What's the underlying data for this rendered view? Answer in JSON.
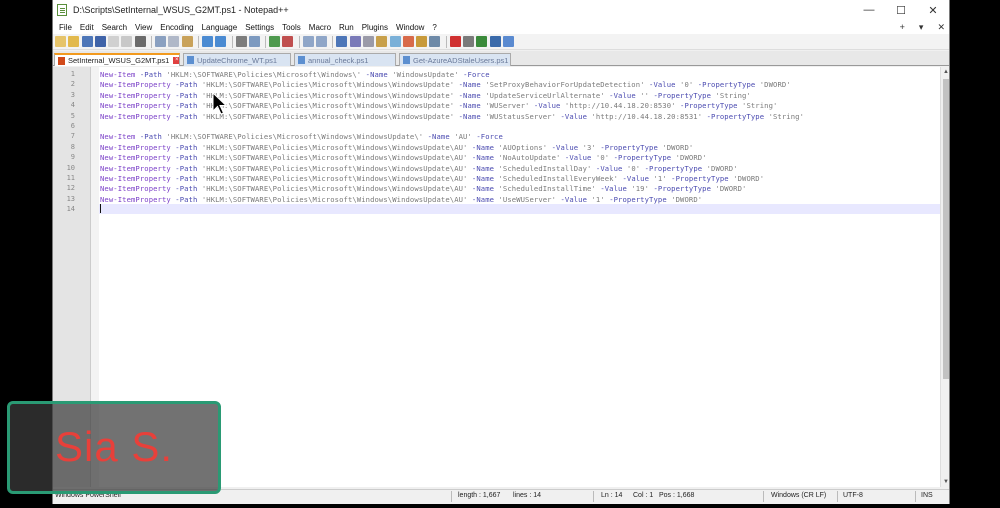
{
  "window": {
    "title": "D:\\Scripts\\SetInternal_WSUS_G2MT.ps1 - Notepad++",
    "controls": {
      "minimize": "—",
      "maximize": "☐",
      "close": "✕"
    }
  },
  "menu": {
    "items": [
      "File",
      "Edit",
      "Search",
      "View",
      "Encoding",
      "Language",
      "Settings",
      "Tools",
      "Macro",
      "Run",
      "Plugins",
      "Window",
      "?"
    ],
    "right": {
      "plus": "+",
      "down": "▾",
      "close": "✕"
    }
  },
  "tabs": [
    {
      "label": "SetInternal_WSUS_G2MT.ps1",
      "active": true
    },
    {
      "label": "UpdateChrome_WT.ps1",
      "active": false
    },
    {
      "label": "annual_check.ps1",
      "active": false
    },
    {
      "label": "Get-AzureADStaleUsers.ps1",
      "active": false
    }
  ],
  "editor": {
    "lines": [
      {
        "n": "1",
        "parts": [
          [
            "cmd",
            "New-Item"
          ],
          [
            "prm",
            " -Path "
          ],
          [
            "str",
            "'HKLM:\\SOFTWARE\\Policies\\Microsoft\\Windows\\'"
          ],
          [
            "prm",
            " -Name "
          ],
          [
            "str",
            "'WindowsUpdate'"
          ],
          [
            "prm",
            " -Force"
          ]
        ]
      },
      {
        "n": "2",
        "parts": [
          [
            "cmd",
            "New-ItemProperty"
          ],
          [
            "prm",
            " -Path "
          ],
          [
            "str",
            "'HKLM:\\SOFTWARE\\Policies\\Microsoft\\Windows\\WindowsUpdate'"
          ],
          [
            "prm",
            " -Name "
          ],
          [
            "str",
            "'SetProxyBehaviorForUpdateDetection'"
          ],
          [
            "prm",
            " -Value "
          ],
          [
            "str",
            "'0'"
          ],
          [
            "prm",
            " -PropertyType "
          ],
          [
            "str",
            "'DWORD'"
          ]
        ]
      },
      {
        "n": "3",
        "parts": [
          [
            "cmd",
            "New-ItemProperty"
          ],
          [
            "prm",
            " -Path "
          ],
          [
            "str",
            "'HKLM:\\SOFTWARE\\Policies\\Microsoft\\Windows\\WindowsUpdate'"
          ],
          [
            "prm",
            " -Name "
          ],
          [
            "str",
            "'UpdateServiceUrlAlternate'"
          ],
          [
            "prm",
            " -Value "
          ],
          [
            "str",
            "''"
          ],
          [
            "prm",
            " -PropertyType "
          ],
          [
            "str",
            "'String'"
          ]
        ]
      },
      {
        "n": "4",
        "parts": [
          [
            "cmd",
            "New-ItemProperty"
          ],
          [
            "prm",
            " -Path "
          ],
          [
            "str",
            "'HKLM:\\SOFTWARE\\Policies\\Microsoft\\Windows\\WindowsUpdate'"
          ],
          [
            "prm",
            " -Name "
          ],
          [
            "str",
            "'WUServer'"
          ],
          [
            "prm",
            " -Value "
          ],
          [
            "str",
            "'http://10.44.18.20:8530'"
          ],
          [
            "prm",
            " -PropertyType "
          ],
          [
            "str",
            "'String'"
          ]
        ]
      },
      {
        "n": "5",
        "parts": [
          [
            "cmd",
            "New-ItemProperty"
          ],
          [
            "prm",
            " -Path "
          ],
          [
            "str",
            "'HKLM:\\SOFTWARE\\Policies\\Microsoft\\Windows\\WindowsUpdate'"
          ],
          [
            "prm",
            " -Name "
          ],
          [
            "str",
            "'WUStatusServer'"
          ],
          [
            "prm",
            " -Value "
          ],
          [
            "str",
            "'http://10.44.18.20:8531'"
          ],
          [
            "prm",
            " -PropertyType "
          ],
          [
            "str",
            "'String'"
          ]
        ]
      },
      {
        "n": "6",
        "parts": []
      },
      {
        "n": "7",
        "parts": [
          [
            "cmd",
            "New-Item"
          ],
          [
            "prm",
            " -Path "
          ],
          [
            "str",
            "'HKLM:\\SOFTWARE\\Policies\\Microsoft\\Windows\\WindowsUpdate\\'"
          ],
          [
            "prm",
            " -Name "
          ],
          [
            "str",
            "'AU'"
          ],
          [
            "prm",
            " -Force"
          ]
        ]
      },
      {
        "n": "8",
        "parts": [
          [
            "cmd",
            "New-ItemProperty"
          ],
          [
            "prm",
            " -Path "
          ],
          [
            "str",
            "'HKLM:\\SOFTWARE\\Policies\\Microsoft\\Windows\\WindowsUpdate\\AU'"
          ],
          [
            "prm",
            " -Name "
          ],
          [
            "str",
            "'AUOptions'"
          ],
          [
            "prm",
            " -Value "
          ],
          [
            "str",
            "'3'"
          ],
          [
            "prm",
            " -PropertyType "
          ],
          [
            "str",
            "'DWORD'"
          ]
        ]
      },
      {
        "n": "9",
        "parts": [
          [
            "cmd",
            "New-ItemProperty"
          ],
          [
            "prm",
            " -Path "
          ],
          [
            "str",
            "'HKLM:\\SOFTWARE\\Policies\\Microsoft\\Windows\\WindowsUpdate\\AU'"
          ],
          [
            "prm",
            " -Name "
          ],
          [
            "str",
            "'NoAutoUpdate'"
          ],
          [
            "prm",
            " -Value "
          ],
          [
            "str",
            "'0'"
          ],
          [
            "prm",
            " -PropertyType "
          ],
          [
            "str",
            "'DWORD'"
          ]
        ]
      },
      {
        "n": "10",
        "parts": [
          [
            "cmd",
            "New-ItemProperty"
          ],
          [
            "prm",
            " -Path "
          ],
          [
            "str",
            "'HKLM:\\SOFTWARE\\Policies\\Microsoft\\Windows\\WindowsUpdate\\AU'"
          ],
          [
            "prm",
            " -Name "
          ],
          [
            "str",
            "'ScheduledInstallDay'"
          ],
          [
            "prm",
            " -Value "
          ],
          [
            "str",
            "'0'"
          ],
          [
            "prm",
            " -PropertyType "
          ],
          [
            "str",
            "'DWORD'"
          ]
        ]
      },
      {
        "n": "11",
        "parts": [
          [
            "cmd",
            "New-ItemProperty"
          ],
          [
            "prm",
            " -Path "
          ],
          [
            "str",
            "'HKLM:\\SOFTWARE\\Policies\\Microsoft\\Windows\\WindowsUpdate\\AU'"
          ],
          [
            "prm",
            " -Name "
          ],
          [
            "str",
            "'ScheduledInstallEveryWeek'"
          ],
          [
            "prm",
            " -Value "
          ],
          [
            "str",
            "'1'"
          ],
          [
            "prm",
            " -PropertyType "
          ],
          [
            "str",
            "'DWORD'"
          ]
        ]
      },
      {
        "n": "12",
        "parts": [
          [
            "cmd",
            "New-ItemProperty"
          ],
          [
            "prm",
            " -Path "
          ],
          [
            "str",
            "'HKLM:\\SOFTWARE\\Policies\\Microsoft\\Windows\\WindowsUpdate\\AU'"
          ],
          [
            "prm",
            " -Name "
          ],
          [
            "str",
            "'ScheduledInstallTime'"
          ],
          [
            "prm",
            " -Value "
          ],
          [
            "str",
            "'19'"
          ],
          [
            "prm",
            " -PropertyType "
          ],
          [
            "str",
            "'DWORD'"
          ]
        ]
      },
      {
        "n": "13",
        "parts": [
          [
            "cmd",
            "New-ItemProperty"
          ],
          [
            "prm",
            " -Path "
          ],
          [
            "str",
            "'HKLM:\\SOFTWARE\\Policies\\Microsoft\\Windows\\WindowsUpdate\\AU'"
          ],
          [
            "prm",
            " -Name "
          ],
          [
            "str",
            "'UseWUServer'"
          ],
          [
            "prm",
            " -Value "
          ],
          [
            "str",
            "'1'"
          ],
          [
            "prm",
            " -PropertyType "
          ],
          [
            "str",
            "'DWORD'"
          ]
        ]
      },
      {
        "n": "14",
        "parts": []
      }
    ],
    "current_line": 14
  },
  "status": {
    "file_type": "Windows PowerShell",
    "length": "length : 1,667",
    "lines": "lines : 14",
    "ln": "Ln : 14",
    "col": "Col : 1",
    "pos": "Pos : 1,668",
    "eol": "Windows (CR LF)",
    "encoding": "UTF-8",
    "mode": "INS"
  },
  "watermark": {
    "text": "Sia S."
  },
  "colors": {
    "keyword": "#7b40c8",
    "parameter": "#4a4ab0",
    "string": "#7a7a7a",
    "active_tab_accent": "#f29a1f",
    "watermark_border": "#2a9a74",
    "watermark_text": "#e8403a"
  },
  "toolbar_icons": [
    "new-icon",
    "open-icon",
    "save-icon",
    "save-all-icon",
    "close-icon",
    "close-all-icon",
    "print-icon",
    "cut-icon",
    "copy-icon",
    "paste-icon",
    "undo-icon",
    "redo-icon",
    "find-icon",
    "replace-icon",
    "zoom-in-icon",
    "zoom-out-icon",
    "sync-v-icon",
    "sync-h-icon",
    "word-wrap-icon",
    "all-chars-icon",
    "indent-guide-icon",
    "udl-icon",
    "doc-map-icon",
    "function-list-icon",
    "folder-workspace-icon",
    "monitor-icon",
    "record-icon",
    "stop-icon",
    "play-icon",
    "play-multi-icon",
    "save-macro-icon"
  ]
}
